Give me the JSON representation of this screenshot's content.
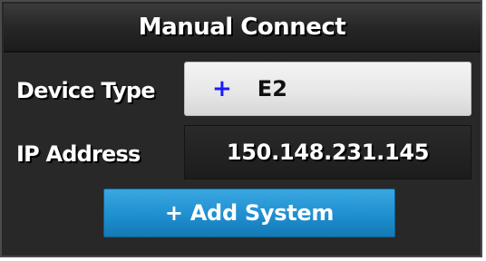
{
  "dialog": {
    "title": "Manual Connect"
  },
  "form": {
    "device_type": {
      "label": "Device Type",
      "icon": "plus-icon",
      "icon_glyph": "+",
      "value": "E2"
    },
    "ip_address": {
      "label": "IP Address",
      "value": "150.148.231.145"
    }
  },
  "actions": {
    "add_system_label": "+ Add System"
  },
  "colors": {
    "panel_background": "#282828",
    "select_background": "#e6e6e6",
    "plus_icon": "#1a1aff",
    "button_accent": "#1e8fd0"
  }
}
